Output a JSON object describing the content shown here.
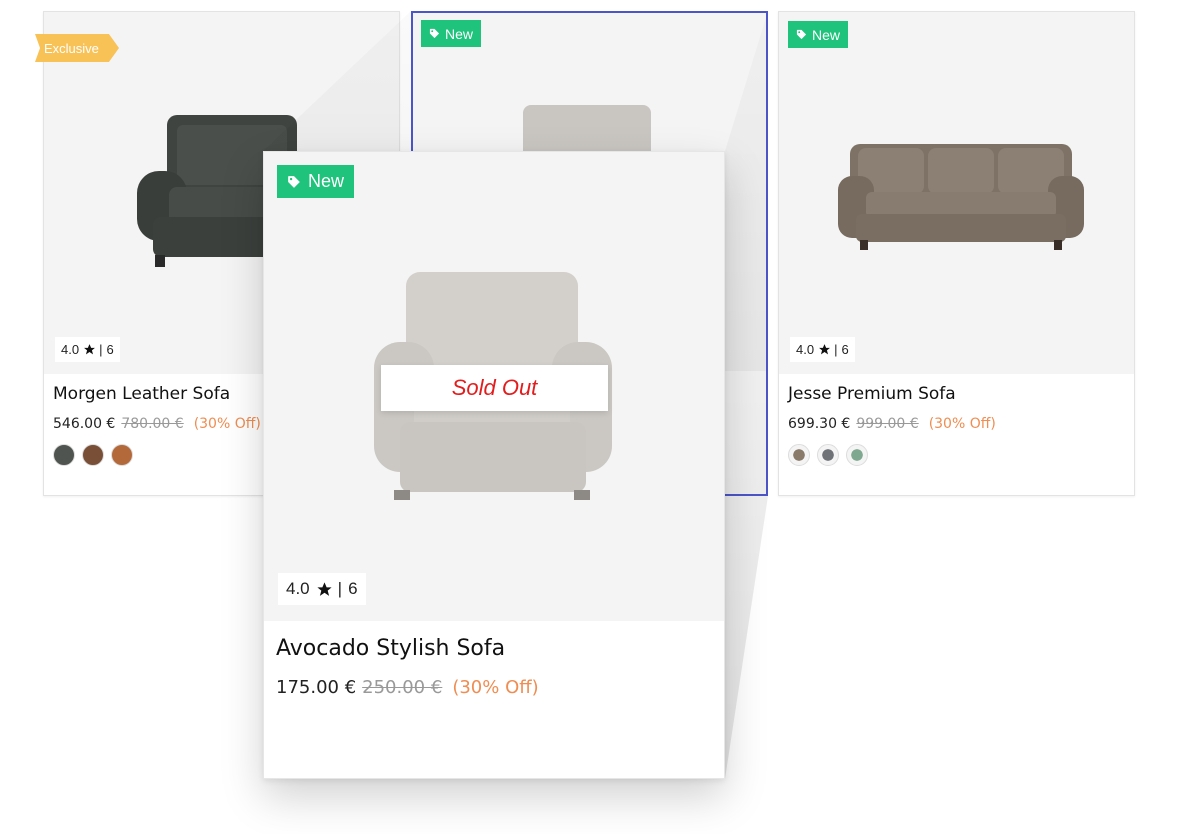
{
  "products": [
    {
      "badge": "Exclusive",
      "rating": "4.0",
      "reviews": "6",
      "title": "Morgen Leather Sofa",
      "price": "546.00 €",
      "old_price": "780.00 €",
      "discount": "(30% Off)",
      "swatches": [
        "#4f5450",
        "#7a4f38",
        "#b4693a"
      ]
    },
    {
      "badge": "New",
      "rating": "4.0",
      "reviews": "6",
      "title": "Avocado Stylish Sofa",
      "price": "175.00 €",
      "old_price": "250.00 €",
      "discount": "(30% Off)",
      "status": "Sold Out"
    },
    {
      "badge": "New",
      "rating": "4.0",
      "reviews": "6",
      "title": "Jesse Premium Sofa",
      "price": "699.30 €",
      "old_price": "999.00 €",
      "discount": "(30% Off)",
      "swatches": [
        "#8a7a6a",
        "#6f7378",
        "#7fa890"
      ]
    }
  ],
  "icons": {
    "tag": "tag-icon",
    "star": "star-icon"
  },
  "colors": {
    "new_badge": "#1fc37b",
    "exclusive_badge": "#f8c257",
    "sold_out": "#e31d1d",
    "discount": "#ef8d52",
    "highlight": "#4b55c8"
  }
}
